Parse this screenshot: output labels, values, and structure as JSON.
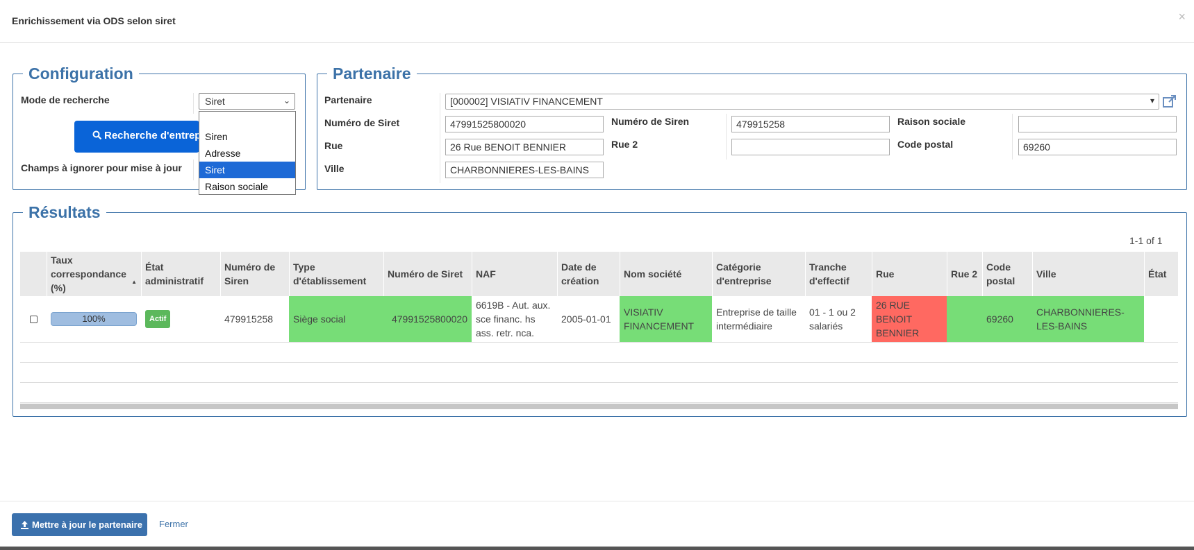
{
  "header": {
    "title": "Enrichissement via ODS selon siret",
    "close_label": "×"
  },
  "configuration": {
    "legend": "Configuration",
    "mode_label": "Mode de recherche",
    "mode_value": "Siret",
    "search_button": "Recherche d'entreprise",
    "ignore_label": "Champs à ignorer pour mise à jour",
    "dropdown_options": [
      "",
      "Siren",
      "Adresse",
      "Siret",
      "Raison sociale"
    ]
  },
  "partenaire": {
    "legend": "Partenaire",
    "partner_label": "Partenaire",
    "partner_value": "[000002] VISIATIV FINANCEMENT",
    "siret_label": "Numéro de Siret",
    "siret_value": "47991525800020",
    "siren_label": "Numéro de Siren",
    "siren_value": "479915258",
    "raison_label": "Raison sociale",
    "raison_value": "",
    "rue_label": "Rue",
    "rue_value": "26 Rue BENOIT BENNIER",
    "rue2_label": "Rue 2",
    "rue2_value": "",
    "cp_label": "Code postal",
    "cp_value": "69260",
    "ville_label": "Ville",
    "ville_value": "CHARBONNIERES-LES-BAINS"
  },
  "results": {
    "legend": "Résultats",
    "pagination": "1-1 of 1",
    "columns": [
      "Taux correspondance (%)",
      "État administratif",
      "Numéro de Siren",
      "Type d'établissement",
      "Numéro de Siret",
      "NAF",
      "Date de création",
      "Nom société",
      "Catégorie d'entreprise",
      "Tranche d'effectif",
      "Rue",
      "Rue 2",
      "Code postal",
      "Ville",
      "État"
    ],
    "row": {
      "taux": "100%",
      "taux_value": 1.0,
      "etat": "Actif",
      "siren": "479915258",
      "type": "Siège social",
      "siret": "47991525800020",
      "naf": "6619B - Aut. aux. sce financ. hs ass. retr. nca.",
      "date": "2005-01-01",
      "nom": "VISIATIV FINANCEMENT",
      "categorie": "Entreprise de taille intermédiaire",
      "tranche": "01 - 1 ou 2 salariés",
      "rue": "26 RUE BENOIT BENNIER",
      "rue2": "",
      "cp": "69260",
      "ville": "CHARBONNIERES-LES-BAINS",
      "etat_final": ""
    }
  },
  "footer": {
    "update_button": "Mettre à jour le partenaire",
    "close_link": "Fermer"
  },
  "colors": {
    "accent": "#3c72a8",
    "primary_button": "#0a64d8",
    "match_green": "#77dd77",
    "mismatch_red": "#ff6961"
  }
}
